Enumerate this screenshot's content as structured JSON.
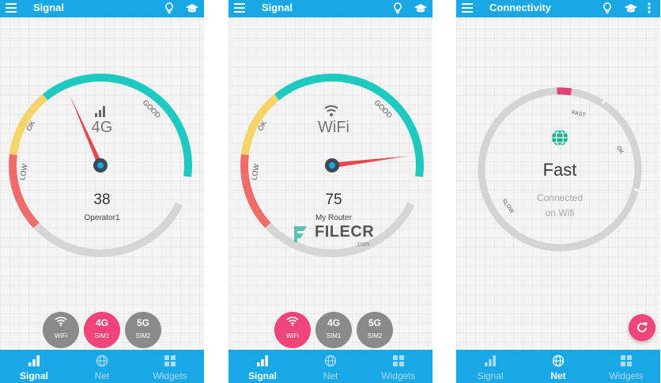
{
  "screens": [
    {
      "title": "Signal",
      "gauge": {
        "network_label": "4G",
        "value": "38",
        "operator": "Operator1",
        "labels": {
          "low": "LOW",
          "ok": "OK",
          "good": "GOOD"
        },
        "needle_fraction": 0.38
      },
      "sim_chips": [
        {
          "top": "",
          "bottom": "WiFi",
          "icon": "wifi-icon",
          "active": false
        },
        {
          "top": "4G",
          "bottom": "SIM1",
          "active": true
        },
        {
          "top": "5G",
          "bottom": "SIM2",
          "active": false
        }
      ],
      "nav": [
        {
          "label": "Signal",
          "icon": "signal-bars-icon",
          "active": true
        },
        {
          "label": "Net",
          "icon": "globe-icon",
          "active": false
        },
        {
          "label": "Widgets",
          "icon": "widgets-icon",
          "active": false
        }
      ]
    },
    {
      "title": "Signal",
      "gauge": {
        "network_label": "WiFi",
        "value": "75",
        "operator": "My Router",
        "labels": {
          "low": "LOW",
          "ok": "OK",
          "good": "GOOD"
        },
        "needle_fraction": 0.75
      },
      "sim_chips": [
        {
          "top": "",
          "bottom": "WiFi",
          "icon": "wifi-icon",
          "active": true
        },
        {
          "top": "4G",
          "bottom": "SIM1",
          "active": false
        },
        {
          "top": "5G",
          "bottom": "SIM2",
          "active": false
        }
      ],
      "nav": [
        {
          "label": "Signal",
          "icon": "signal-bars-icon",
          "active": true
        },
        {
          "label": "Net",
          "icon": "globe-icon",
          "active": false
        },
        {
          "label": "Widgets",
          "icon": "widgets-icon",
          "active": false
        }
      ]
    },
    {
      "title": "Connectivity",
      "speed": {
        "status": "Fast",
        "line1": "Connected",
        "line2": "on Wifi",
        "labels": {
          "slow": "SLOW",
          "ok": "OK",
          "fast": "FAST"
        }
      },
      "nav": [
        {
          "label": "Signal",
          "icon": "signal-bars-icon",
          "active": false
        },
        {
          "label": "Net",
          "icon": "globe-icon",
          "active": true
        },
        {
          "label": "Widgets",
          "icon": "widgets-icon",
          "active": false
        }
      ]
    }
  ],
  "watermark": {
    "text": "FILECR",
    "sub": ".com"
  },
  "colors": {
    "primary": "#1aa7e6",
    "accent": "#f0447a",
    "good": "#1ec9c0",
    "ok": "#f5d56a",
    "low": "#f26b6b",
    "track": "#d6d6d6",
    "needle": "#e8474b",
    "globe": "#19b38a"
  }
}
